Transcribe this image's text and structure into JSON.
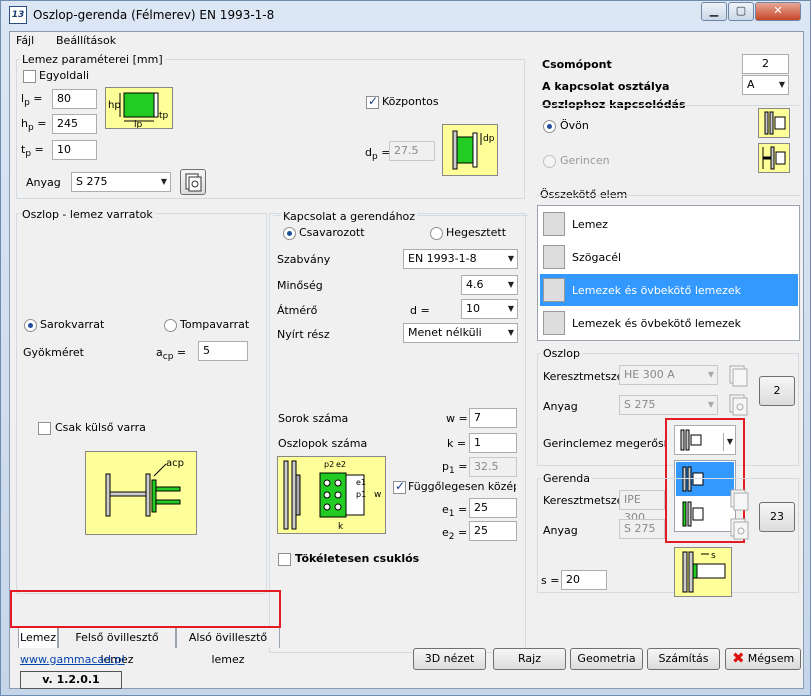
{
  "window": {
    "title": "Oszlop-gerenda (Félmerev) EN 1993-1-8",
    "app_badge": "13"
  },
  "menu": {
    "file": "Fájl",
    "settings": "Beállítások"
  },
  "plate": {
    "group_label": "Lemez paraméterei [mm]",
    "one_sided": "Egyoldali",
    "lp_label": "l",
    "lp_sub": "p",
    "lp_value": "80",
    "hp_label": "h",
    "hp_sub": "p",
    "hp_value": "245",
    "tp_label": "t",
    "tp_sub": "p",
    "tp_value": "10",
    "material_label": "Anyag",
    "material_value": "S 275",
    "central_label": "Központos",
    "dp_label": "d",
    "dp_sub": "p",
    "dp_value": "27.5",
    "sketch_hp": "hp",
    "sketch_lp": "lp",
    "sketch_tp": "tp",
    "sketch_dp": "dp"
  },
  "right_top": {
    "node_label": "Csomópont",
    "node_value": "2",
    "class_label": "A kapcsolat osztálya",
    "class_value": "A",
    "col_conn_label": "Oszlophoz kapcsolódás",
    "flange": "Övön",
    "web": "Gerincen"
  },
  "connector": {
    "label": "Összekötő elem",
    "items": [
      "Lemez",
      "Szögacél",
      "Lemezek és övbekötő lemezek",
      "Lemezek és övbekötő lemezek"
    ],
    "selected_index": 2
  },
  "welds": {
    "group_label": "Oszlop - lemez varratok",
    "corner": "Sarokvarrat",
    "butt": "Tompavarrat",
    "root_label": "Gyökméret",
    "acp_label": "a",
    "acp_sub": "cp",
    "acp_value": "5",
    "outer_only": "Csak külső varra",
    "sketch_acp": "acp"
  },
  "beam_conn": {
    "group_label": "Kapcsolat a gerendához",
    "bolted": "Csavarozott",
    "welded": "Hegesztett",
    "standard_label": "Szabvány",
    "standard_value": "EN 1993-1-8",
    "grade_label": "Minőség",
    "grade_value": "4.6",
    "diameter_label": "Átmérő",
    "d_label": "d =",
    "d_value": "10",
    "shear_label": "Nyírt rész",
    "shear_value": "Menet nélküli",
    "rows_label": "Sorok száma",
    "w_label": "w =",
    "w_value": "7",
    "cols_label": "Oszlopok száma",
    "k_label": "k =",
    "k_value": "1",
    "p1_label": "p",
    "p1_sub": "1",
    "p1_value": "32.5",
    "vcenter_label": "Függőlegesen középre",
    "e1_label": "e",
    "e1_sub": "1",
    "e1_value": "25",
    "e2_label": "e",
    "e2_sub": "2",
    "e2_value": "25",
    "pinned_label": "Tökéletesen csuklós",
    "sketch": {
      "p2": "p2",
      "e2": "e2",
      "e1": "e1",
      "p1": "p1",
      "w": "w",
      "k": "k"
    }
  },
  "column": {
    "group_label": "Oszlop",
    "section_label": "Keresztmetszet",
    "section_value": "HE  300 A",
    "material_label": "Anyag",
    "material_value": "S 275",
    "node_btn": "2",
    "stiffener_label": "Gerinclemez megerősítése"
  },
  "beam": {
    "group_label": "Gerenda",
    "section_label": "Keresztmetszet",
    "section_value": "IPE 300",
    "material_label": "Anyag",
    "material_value": "S 275",
    "node_btn": "23",
    "s_label": "s =",
    "s_value": "20",
    "sketch_s": "s"
  },
  "tabs": [
    "Lemez",
    "Felső övillesztő lemez",
    "Alsó övillesztő lemez"
  ],
  "footer": {
    "link": "www.gammacad.pl",
    "version": "v. 1.2.0.1",
    "view3d": "3D nézet",
    "drawing": "Rajz",
    "geometry": "Geometria",
    "calc": "Számítás",
    "cancel": "Mégsem"
  },
  "colors": {
    "accent_select": "#3399ff",
    "highlight": "#e31b23",
    "sketch_fill": "#ffff99",
    "plate_green": "#22cc22"
  }
}
